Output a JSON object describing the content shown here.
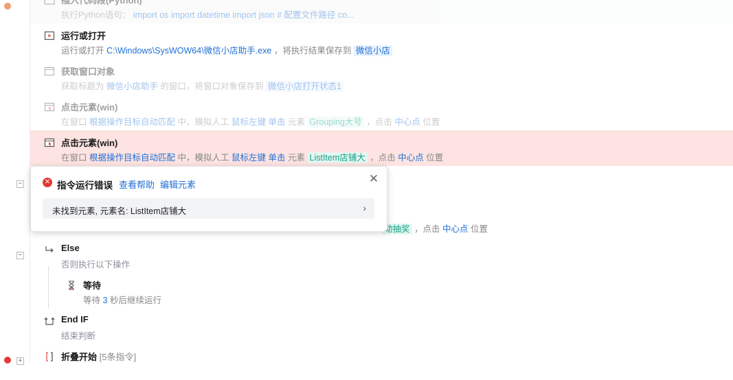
{
  "rows": {
    "python": {
      "title": "插入代码段(Python)",
      "prefix": "执行Python语句：",
      "code": "import os import datetime import json  # 配置文件路径 co..."
    },
    "run": {
      "title": "运行或打开",
      "p1": "运行或打开",
      "path": "C:\\Windows\\SysWOW64\\微信小店助手.exe",
      "p2": "，将执行结果保存到",
      "var": "微信小店"
    },
    "getwin": {
      "title": "获取窗口对象",
      "p1": "获取标题为",
      "win": "微信小店助手",
      "p2": "的窗口，将窗口对象保存到",
      "var": "微信小店打开状态1"
    },
    "click1": {
      "title": "点击元素(win)",
      "p1": "在窗口",
      "match": "根据操作目标自动匹配",
      "p2": "中，模拟人工",
      "btn": "鼠标左键",
      "act": "单击",
      "p3": "元素",
      "el": "Grouping大号",
      "p4": "，点击",
      "pos": "中心点",
      "p5": "位置"
    },
    "click2": {
      "title": "点击元素(win)",
      "p1": "在窗口",
      "match": "根据操作目标自动匹配",
      "p2": "中，模拟人工",
      "btn": "鼠标左键",
      "act": "单击",
      "p3": "元素",
      "el": "ListItem店铺大",
      "p4": "，点击",
      "pos": "中心点",
      "p5": "位置"
    },
    "hidden": {
      "el_tail": "动抽奖",
      "p4": "，点击",
      "pos": "中心点",
      "p5": "位置"
    },
    "else": {
      "title": "Else",
      "sub": "否则执行以下操作"
    },
    "wait": {
      "title": "等待",
      "p1": "等待",
      "num": "3",
      "p2": "秒后继续运行"
    },
    "endif": {
      "title": "End IF",
      "sub": "结束判断"
    },
    "fold": {
      "title": "折叠开始",
      "count": "[5条指令]"
    }
  },
  "popup": {
    "title": "指令运行错误",
    "help_link": "查看帮助",
    "edit_link": "编辑元素",
    "message": "未找到元素, 元素名: ListItem店铺大"
  },
  "colors": {
    "accent": "#1f6fd6",
    "error_bg": "#fde3e1",
    "error_icon": "#e53935",
    "green_tag": "#17a289"
  }
}
